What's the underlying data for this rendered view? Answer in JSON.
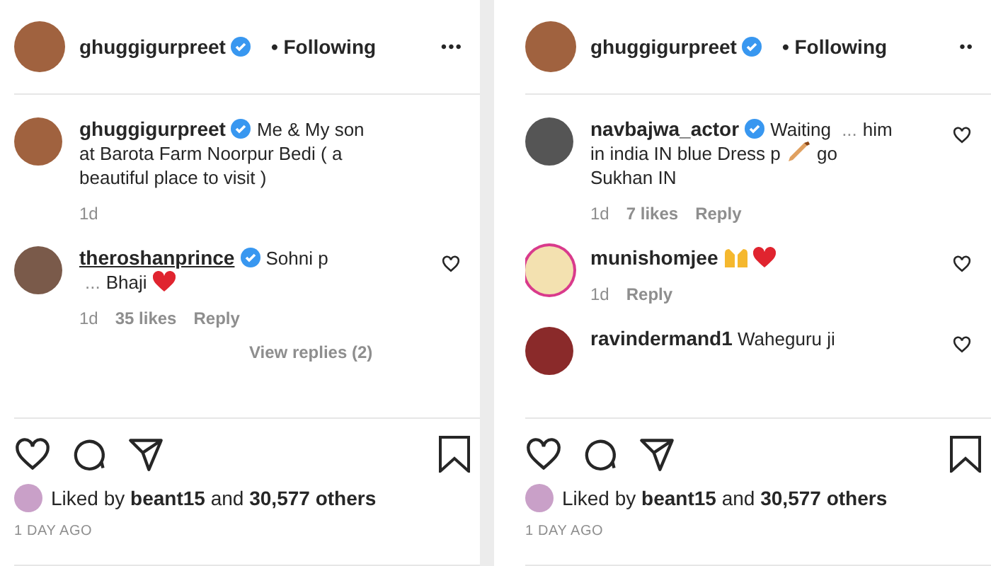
{
  "panels": [
    {
      "header": {
        "username": "ghuggigurpreet",
        "verified": true,
        "follow": "• Following",
        "more": "•••"
      },
      "caption": {
        "username": "ghuggigurpreet",
        "verified": true,
        "parts": [
          {
            "kind": "text",
            "text": "Me & My son at Barota Farm Noorpur Bedi ( a beautiful place to visit )"
          }
        ],
        "time": "1d"
      },
      "comments": [
        {
          "username": "theroshanprince",
          "underlined": true,
          "verified": true,
          "parts": [
            {
              "kind": "text",
              "text": "Sohni p"
            },
            {
              "kind": "ellipsis",
              "text": "..."
            },
            {
              "kind": "text",
              "text": "Bhaji"
            },
            {
              "kind": "heart"
            }
          ],
          "time": "1d",
          "likes": "35 likes",
          "reply": "Reply",
          "replies": "View replies (2)"
        }
      ],
      "liked_by": {
        "prefix": "Liked by",
        "user": "beant15",
        "middle": "and",
        "count": "30,577 others"
      },
      "age": "1 DAY AGO"
    },
    {
      "header": {
        "username": "ghuggigurpreet",
        "verified": true,
        "follow": "• Following",
        "more": "••"
      },
      "comments": [
        {
          "username": "navbajwa_actor",
          "underlined": false,
          "verified": true,
          "parts": [
            {
              "kind": "text",
              "text": "Waiting"
            },
            {
              "kind": "ellipsis",
              "text": "..."
            },
            {
              "kind": "text",
              "text": "him in india IN blue Dress p"
            },
            {
              "kind": "bat"
            },
            {
              "kind": "text",
              "text": "go Sukhan IN"
            }
          ],
          "time": "1d",
          "likes": "7 likes",
          "reply": "Reply"
        },
        {
          "username": "munishomjee",
          "underlined": false,
          "verified": false,
          "parts": [
            {
              "kind": "hands"
            },
            {
              "kind": "heart"
            }
          ],
          "time": "1d",
          "reply": "Reply"
        },
        {
          "username": "ravindermand1",
          "underlined": false,
          "verified": false,
          "parts": [
            {
              "kind": "text",
              "text": "Waheguru ji"
            }
          ]
        }
      ],
      "liked_by": {
        "prefix": "Liked by",
        "user": "beant15",
        "middle": "and",
        "count": "30,577 others"
      },
      "age": "1 DAY AGO"
    }
  ]
}
